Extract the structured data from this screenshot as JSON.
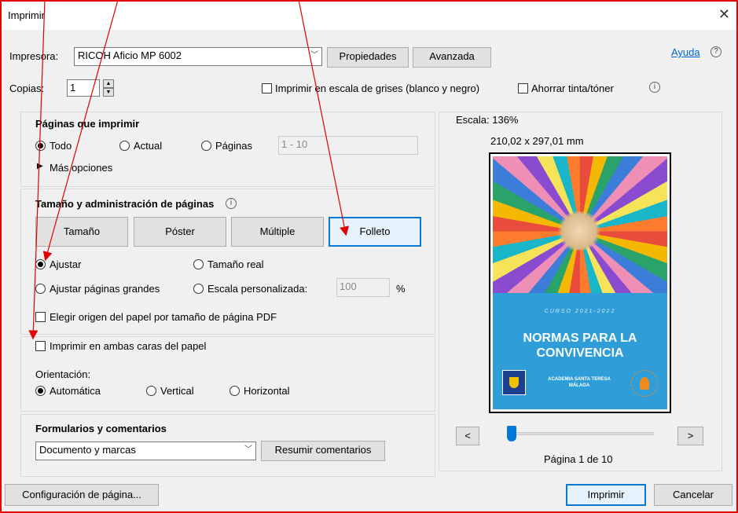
{
  "window": {
    "title": "Imprimir"
  },
  "printer": {
    "label": "Impresora:",
    "value": "RICOH Aficio MP 6002",
    "properties": "Propiedades",
    "advanced": "Avanzada",
    "help": "Ayuda"
  },
  "copies": {
    "label": "Copias:",
    "value": "1",
    "grayscale": "Imprimir en escala de grises (blanco y negro)",
    "save_ink": "Ahorrar tinta/tóner"
  },
  "pages": {
    "heading": "Páginas que imprimir",
    "all": "Todo",
    "current": "Actual",
    "pages": "Páginas",
    "range": "1 - 10",
    "more": "Más opciones"
  },
  "sizing": {
    "heading": "Tamaño y administración de páginas",
    "tabs": [
      "Tamaño",
      "Póster",
      "Múltiple",
      "Folleto"
    ],
    "fit": "Ajustar",
    "actual": "Tamaño real",
    "shrink": "Ajustar páginas grandes",
    "custom": "Escala personalizada:",
    "custom_value": "100",
    "percent": "%",
    "paper_source": "Elegir origen del papel por tamaño de página PDF"
  },
  "duplex": {
    "label": "Imprimir en ambas caras del papel",
    "orientation_label": "Orientación:",
    "auto": "Automática",
    "vertical": "Vertical",
    "horizontal": "Horizontal"
  },
  "forms": {
    "heading": "Formularios y comentarios",
    "value": "Documento y marcas",
    "summarize": "Resumir comentarios"
  },
  "preview": {
    "scale": "Escala: 136%",
    "dimensions": "210,02 x 297,01 mm",
    "prev": "<",
    "next": ">",
    "page_info": "Página 1 de 10",
    "page_position": 0.0,
    "cover_curso": "CURSO 2021-2022",
    "cover_title_1": "NORMAS PARA LA",
    "cover_title_2": "CONVIVENCIA",
    "cover_school_1": "ACADEMIA SANTA TERESA",
    "cover_school_2": "MÁLAGA"
  },
  "footer": {
    "page_setup": "Configuración de página...",
    "print": "Imprimir",
    "cancel": "Cancelar"
  },
  "colors": {
    "accent": "#0078d7",
    "annotation": "#e00000",
    "cover_blue": "#2f9ed8"
  }
}
